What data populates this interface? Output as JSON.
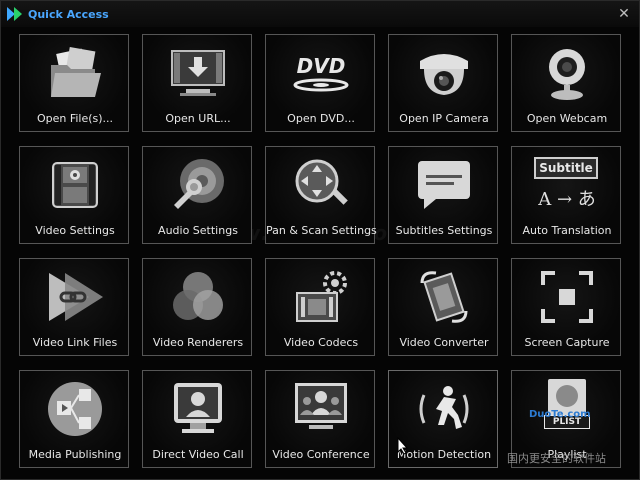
{
  "window": {
    "title": "Quick Access",
    "close_glyph": "✕"
  },
  "tiles": [
    {
      "label": "Open File(s)...",
      "icon": "folder-open-icon"
    },
    {
      "label": "Open URL...",
      "icon": "download-url-icon"
    },
    {
      "label": "Open DVD...",
      "icon": "dvd-icon"
    },
    {
      "label": "Open IP Camera",
      "icon": "ip-camera-icon"
    },
    {
      "label": "Open Webcam",
      "icon": "webcam-icon"
    },
    {
      "label": "Video Settings",
      "icon": "video-settings-icon"
    },
    {
      "label": "Audio Settings",
      "icon": "audio-settings-icon"
    },
    {
      "label": "Pan & Scan Settings",
      "icon": "pan-scan-icon"
    },
    {
      "label": "Subtitles Settings",
      "icon": "subtitles-icon"
    },
    {
      "label": "Auto Translation",
      "icon": "translation-icon",
      "caption": "Subtitle",
      "glyphs": "A → あ"
    },
    {
      "label": "Video Link Files",
      "icon": "video-link-icon"
    },
    {
      "label": "Video Renderers",
      "icon": "renderers-icon"
    },
    {
      "label": "Video Codecs",
      "icon": "codecs-icon"
    },
    {
      "label": "Video Converter",
      "icon": "converter-icon"
    },
    {
      "label": "Screen Capture",
      "icon": "screen-capture-icon"
    },
    {
      "label": "Media Publishing",
      "icon": "publishing-icon"
    },
    {
      "label": "Direct Video Call",
      "icon": "video-call-icon"
    },
    {
      "label": "Video Conference",
      "icon": "conference-icon"
    },
    {
      "label": "Motion Detection",
      "icon": "motion-detection-icon"
    },
    {
      "label": "Playlist",
      "icon": "playlist-icon",
      "caption": "PLIST"
    }
  ],
  "overlay": {
    "watermark": "www.DuoTe.com",
    "brand_text": "DuoTe.com",
    "brand_chinese": "国内更安全的软件站"
  }
}
